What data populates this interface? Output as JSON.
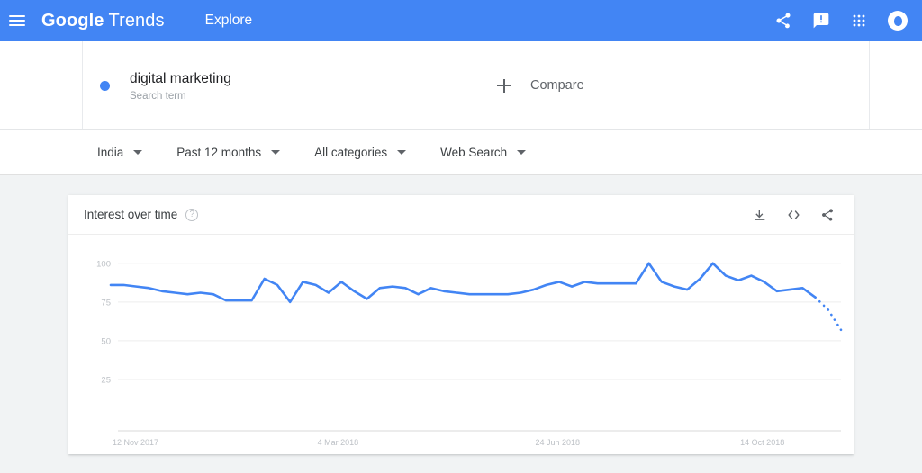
{
  "appbar": {
    "menu_icon": "hamburger-menu-icon",
    "brand_google": "Google",
    "brand_product": "Trends",
    "explore": "Explore",
    "icons": [
      "share-icon",
      "feedback-icon",
      "apps-grid-icon",
      "account-avatar-icon"
    ],
    "background": "#4285f4"
  },
  "query": {
    "dot_color": "#4285f4",
    "term": "digital marketing",
    "term_type": "Search term",
    "compare_label": "Compare",
    "compare_icon": "plus-icon"
  },
  "filters": [
    {
      "label": "India",
      "name": "location"
    },
    {
      "label": "Past 12 months",
      "name": "time-range"
    },
    {
      "label": "All categories",
      "name": "category"
    },
    {
      "label": "Web Search",
      "name": "search-type"
    }
  ],
  "card": {
    "title": "Interest over time",
    "help_icon": "help-question-icon",
    "actions": [
      {
        "name": "download-icon",
        "label": "download"
      },
      {
        "name": "embed-code-icon",
        "label": "<>"
      },
      {
        "name": "share-icon",
        "label": "share"
      }
    ]
  },
  "chart_data": {
    "type": "line",
    "title": "Interest over time",
    "xlabel": "",
    "ylabel": "",
    "ylim": [
      0,
      108
    ],
    "yticks": [
      25,
      50,
      75,
      100
    ],
    "grid": true,
    "legend": "none",
    "line_color": "#4285f4",
    "xticks": [
      "12 Nov 2017",
      "4 Mar 2018",
      "24 Jun 2018",
      "14 Oct 2018"
    ],
    "xtick_index": [
      0,
      16,
      33,
      49
    ],
    "series": [
      {
        "name": "digital marketing",
        "values": [
          86,
          86,
          85,
          84,
          82,
          81,
          80,
          81,
          80,
          76,
          76,
          76,
          90,
          86,
          75,
          88,
          86,
          81,
          88,
          82,
          77,
          84,
          85,
          84,
          80,
          84,
          82,
          81,
          80,
          80,
          80,
          80,
          81,
          83,
          86,
          88,
          85,
          88,
          87,
          87,
          87,
          87,
          100,
          88,
          85,
          83,
          90,
          100,
          92,
          89,
          92,
          88,
          82,
          83,
          84,
          78
        ]
      }
    ],
    "partial_segment": {
      "note": "dotted trailing segment indicates incomplete data",
      "values": [
        78,
        70,
        57
      ]
    }
  }
}
